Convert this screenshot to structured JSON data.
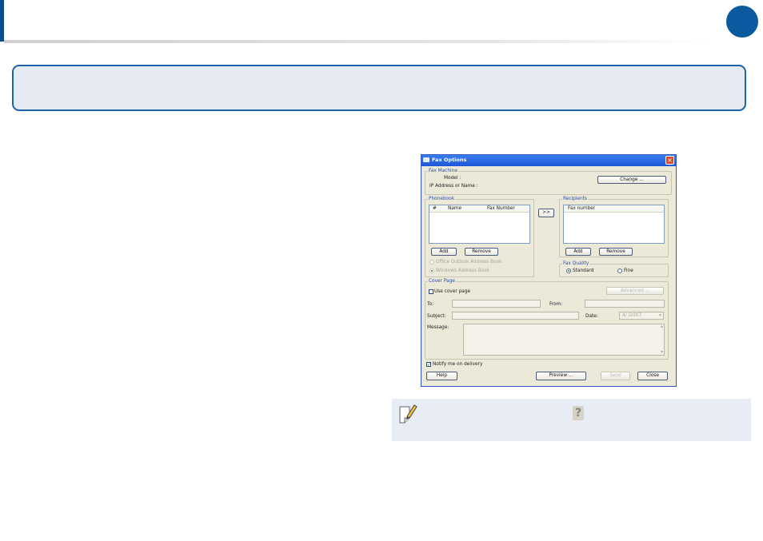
{
  "dialog": {
    "title": "Fax Options",
    "fax_machine": {
      "legend": "Fax Machine",
      "model_label": "Model :",
      "ip_label": "IP Address or Name :",
      "change_button": "Change ..."
    },
    "phonebook": {
      "legend": "Phonebook",
      "columns": [
        "#",
        "Name",
        "Fax Number"
      ],
      "add_button": "Add",
      "remove_button": "Remove",
      "source_options": [
        "Office Outlook Address Book",
        "Windows Address Book"
      ],
      "selected_source": "Windows Address Book"
    },
    "transfer_button": ">>",
    "recipients": {
      "legend": "Recipients",
      "column": "Fax number",
      "add_button": "Add",
      "remove_button": "Remove"
    },
    "fax_quality": {
      "legend": "Fax Quality",
      "options": [
        "Standard",
        "Fine"
      ],
      "selected": "Standard"
    },
    "cover_page": {
      "legend": "Cover Page",
      "use_cover_label": "Use cover page",
      "use_cover_checked": false,
      "advanced_button": "Advanced ...",
      "to_label": "To:",
      "from_label": "From:",
      "subject_label": "Subject:",
      "date_label": "Date:",
      "date_value": "4/  /2007",
      "message_label": "Message:"
    },
    "notify_label": "Notify me on delivery",
    "notify_checked": true,
    "help_button": "Help",
    "preview_button": "Preview ...",
    "send_button": "Send",
    "close_button": "Close"
  },
  "icons": {
    "note": "pencil-note-icon",
    "help": "question-mark-icon",
    "close": "close-icon"
  },
  "colors": {
    "accent": "#0b5aa0",
    "title_box_fill": "#e6ebf3",
    "note_fill": "#e8ecf5"
  }
}
